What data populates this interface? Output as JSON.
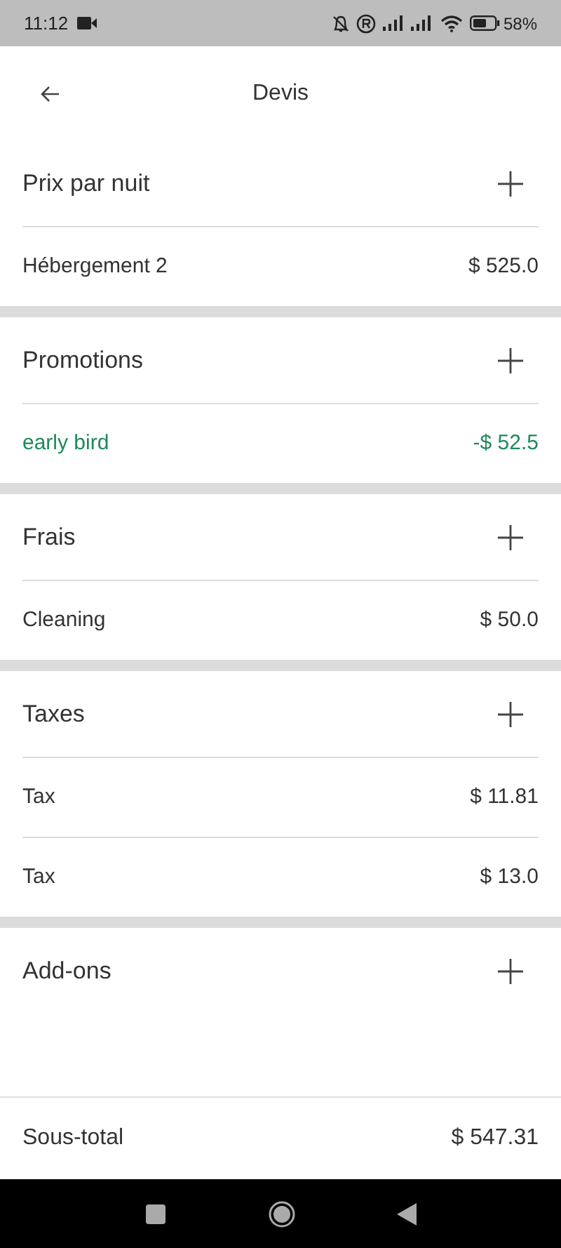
{
  "status_bar": {
    "time": "11:12",
    "battery": "58%"
  },
  "header": {
    "title": "Devis"
  },
  "sections": [
    {
      "title": "Prix par nuit",
      "items": [
        {
          "label": "Hébergement 2",
          "amount": "$ 525.0",
          "kind": "charge"
        }
      ]
    },
    {
      "title": "Promotions",
      "items": [
        {
          "label": "early bird",
          "amount": "-$ 52.5",
          "kind": "discount"
        }
      ]
    },
    {
      "title": "Frais",
      "items": [
        {
          "label": "Cleaning",
          "amount": "$ 50.0",
          "kind": "charge"
        }
      ]
    },
    {
      "title": "Taxes",
      "items": [
        {
          "label": "Tax",
          "amount": "$ 11.81",
          "kind": "charge"
        },
        {
          "label": "Tax",
          "amount": "$ 13.0",
          "kind": "charge"
        }
      ]
    },
    {
      "title": "Add-ons"
    }
  ],
  "subtotal": {
    "label": "Sous-total",
    "amount": "$ 547.31"
  }
}
